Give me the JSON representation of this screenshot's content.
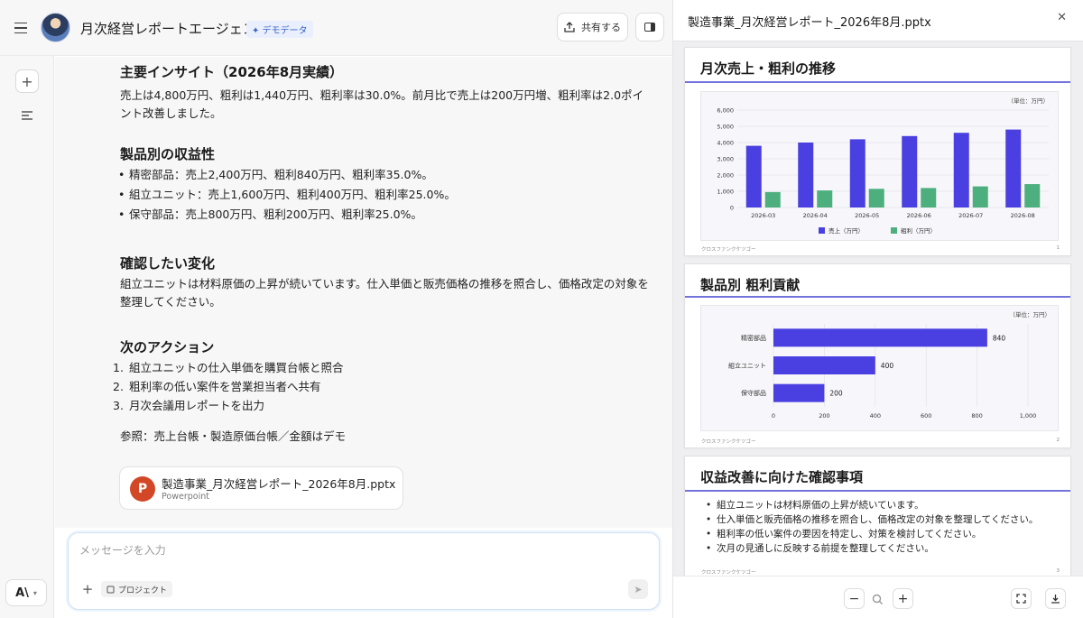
{
  "header": {
    "title": "月次経営レポートエージェント",
    "demo_badge": "✦ デモデータ",
    "share_label": "共有する"
  },
  "chat": {
    "section1": {
      "heading": "主要インサイト（2026年8月実績）",
      "body": "売上は4,800万円、粗利は1,440万円、粗利率は30.0%。前月比で売上は200万円増、粗利率は2.0ポイント改善しました。"
    },
    "section2": {
      "heading": "製品別の収益性",
      "items": [
        "精密部品：売上2,400万円、粗利840万円、粗利率35.0%。",
        "組立ユニット：売上1,600万円、粗利400万円、粗利率25.0%。",
        "保守部品：売上800万円、粗利200万円、粗利率25.0%。"
      ]
    },
    "section3": {
      "heading": "確認したい変化",
      "body": "組立ユニットは材料原価の上昇が続いています。仕入単価と販売価格の推移を照合し、価格改定の対象を整理してください。"
    },
    "section4": {
      "heading": "次のアクション",
      "items": [
        "組立ユニットの仕入単価を購買台帳と照合",
        "粗利率の低い案件を営業担当者へ共有",
        "月次会議用レポートを出力"
      ]
    },
    "reference": "参照：売上台帳・製造原価台帳／金額はデモ",
    "file": {
      "name": "製造事業_月次経営レポート_2026年8月.pptx",
      "type": "Powerpoint"
    }
  },
  "composer": {
    "placeholder": "メッセージを入力",
    "project_label": "プロジェクト"
  },
  "panel": {
    "title": "製造事業_月次経営レポート_2026年8月.pptx",
    "footer_text": "クロスファンクケツゴー",
    "slides": [
      {
        "title": "月次売上・粗利の推移",
        "page": "1"
      },
      {
        "title": "製品別 粗利貢献",
        "page": "2"
      },
      {
        "title": "収益改善に向けた確認事項",
        "page": "3",
        "bullets": [
          "組立ユニットは材料原価の上昇が続いています。",
          "仕入単価と販売価格の推移を照合し、価格改定の対象を整理してください。",
          "粗利率の低い案件の要因を特定し、対策を検討してください。",
          "次月の見通しに反映する前提を整理してください。"
        ]
      }
    ]
  },
  "chart_data": [
    {
      "type": "bar",
      "unit_label": "（単位：万円）",
      "categories": [
        "2026-03",
        "2026-04",
        "2026-05",
        "2026-06",
        "2026-07",
        "2026-08"
      ],
      "series": [
        {
          "name": "売上（万円）",
          "color": "#4a3fe0",
          "values": [
            3800,
            4000,
            4200,
            4400,
            4600,
            4800
          ]
        },
        {
          "name": "粗利（万円）",
          "color": "#4caf7d",
          "values": [
            950,
            1050,
            1150,
            1200,
            1300,
            1440
          ]
        }
      ],
      "ylim": [
        0,
        6000
      ],
      "yticks": [
        "0",
        "1,000",
        "2,000",
        "3,000",
        "4,000",
        "5,000",
        "6,000"
      ],
      "legend": "bottom",
      "grid": true
    },
    {
      "type": "bar",
      "orientation": "horizontal",
      "unit_label": "（単位：万円）",
      "categories": [
        "精密部品",
        "組立ユニット",
        "保守部品"
      ],
      "values": [
        840,
        400,
        200
      ],
      "color": "#4a3fe0",
      "xlim": [
        0,
        1000
      ],
      "xticks": [
        "0",
        "200",
        "400",
        "600",
        "800",
        "1,000"
      ],
      "grid": true
    }
  ]
}
